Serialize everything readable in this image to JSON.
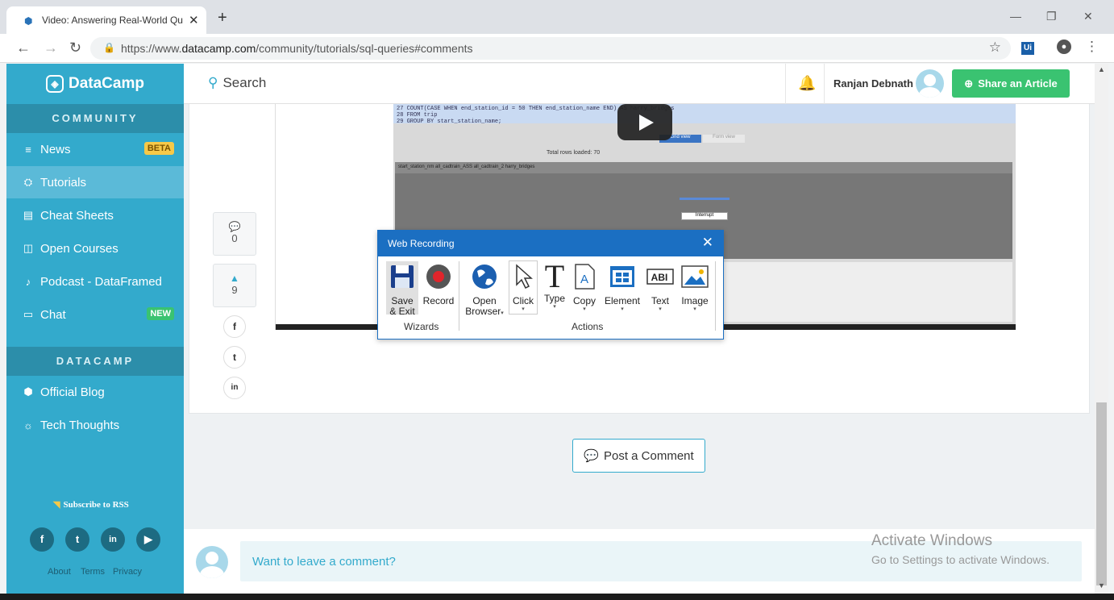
{
  "browser": {
    "tab_title": "Video: Answering Real-World Qu",
    "tab_close": "✕",
    "new_tab": "+",
    "url_prefix": "https://www.",
    "url_domain": "datacamp.com",
    "url_path": "/community/tutorials/sql-queries#comments",
    "ext_label": "Ui"
  },
  "sidebar": {
    "brand": "DataCamp",
    "section1": "COMMUNITY",
    "items": [
      {
        "label": "News",
        "icon": "≡",
        "badge": "BETA"
      },
      {
        "label": "Tutorials",
        "icon": "🎓",
        "badge": ""
      },
      {
        "label": "Cheat Sheets",
        "icon": "▤",
        "badge": ""
      },
      {
        "label": "Open Courses",
        "icon": "◫",
        "badge": ""
      },
      {
        "label": "Podcast - DataFramed",
        "icon": "🎙",
        "badge": ""
      },
      {
        "label": "Chat",
        "icon": "▭",
        "badge": "NEW"
      }
    ],
    "section2": "DATACAMP",
    "items2": [
      {
        "label": "Official Blog",
        "icon": "⬢"
      },
      {
        "label": "Tech Thoughts",
        "icon": "💡"
      }
    ],
    "rss": "Subscribe to RSS",
    "footer": [
      "About",
      "Terms",
      "Privacy"
    ],
    "colors": {
      "bg": "#33aacc",
      "active": "#5bbad8",
      "section": "#2c8eaa",
      "beta": "#f7c948",
      "new": "#3ac371"
    }
  },
  "header": {
    "search_label": "Search",
    "user_name": "Ranjan Debnath",
    "share_label": "Share an Article",
    "share_color": "#3ac371"
  },
  "article": {
    "comment_count": "0",
    "vote_count": "9",
    "post_comment": "Post a Comment",
    "comment_placeholder": "Want to leave a comment?",
    "video": {
      "sql_lines": [
        "27   COUNT(CASE WHEN end_station_id = 50 THEN end_station_name END) AS harry_bridges",
        "28 FROM trip",
        "29 GROUP BY start_station_name;"
      ],
      "rows_loaded": "Total rows loaded: 70",
      "columns": "start_station_nm   all_cadtrain_ASS   all_cadtrain_2   harry_bridges",
      "interrupt": "Interrupt",
      "grid_view": "Grid view",
      "form_view": "Form view"
    }
  },
  "web_recording": {
    "title": "Web Recording",
    "wizards_group": "Wizards",
    "actions_group": "Actions",
    "tools": {
      "save": [
        "Save",
        "& Exit"
      ],
      "record": "Record",
      "open": [
        "Open",
        "Browser"
      ],
      "click": "Click",
      "type": "Type",
      "copy": "Copy",
      "element": "Element",
      "text": "Text",
      "image": "Image"
    }
  },
  "watermark": {
    "line1": "Activate Windows",
    "line2": "Go to Settings to activate Windows."
  }
}
